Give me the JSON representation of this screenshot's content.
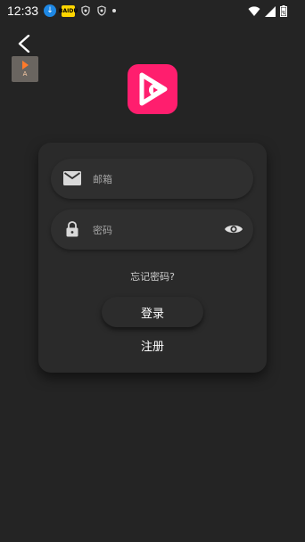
{
  "status_bar": {
    "time": "12:33",
    "app_icon_text": "BAIDU",
    "icons": [
      "download-icon",
      "yellow-app-icon",
      "shield-icon",
      "shield-icon",
      "dot-icon",
      "wifi-icon",
      "signal-icon",
      "battery-icon"
    ]
  },
  "header": {
    "back_icon": "chevron-left-icon",
    "badge_letter": "A"
  },
  "logo": {
    "color": "#ff1e6e",
    "icon": "video-play-logo-icon"
  },
  "login_form": {
    "email": {
      "placeholder": "邮箱",
      "icon": "mail-icon"
    },
    "password": {
      "placeholder": "密码",
      "icon": "lock-icon",
      "toggle_icon": "eye-icon"
    },
    "forgot_password": "忘记密码?",
    "login_button": "登录",
    "register_link": "注册"
  }
}
